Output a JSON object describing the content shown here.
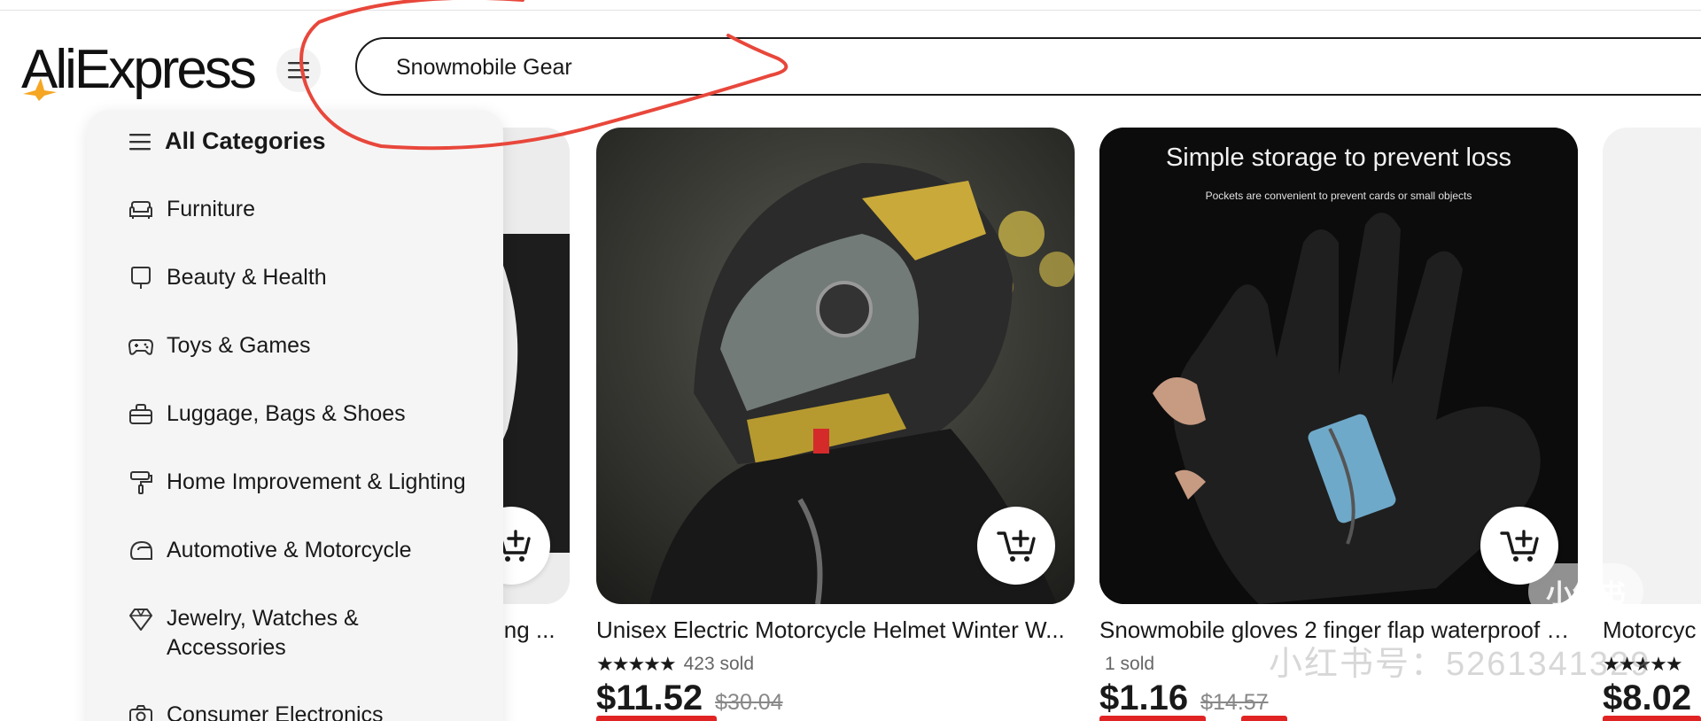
{
  "header": {
    "logo_text": "AliExpress",
    "menu_icon": "hamburger-icon",
    "search": {
      "value": "Snowmobile Gear",
      "placeholder": ""
    }
  },
  "categories": {
    "title": "All Categories",
    "items": [
      {
        "label": "Furniture",
        "icon": "sofa-icon"
      },
      {
        "label": "Beauty & Health",
        "icon": "mirror-icon"
      },
      {
        "label": "Toys & Games",
        "icon": "gamepad-icon"
      },
      {
        "label": "Luggage, Bags & Shoes",
        "icon": "bag-icon"
      },
      {
        "label": "Home Improvement & Lighting",
        "icon": "paint-roller-icon"
      },
      {
        "label": "Automotive & Motorcycle",
        "icon": "helmet-icon"
      },
      {
        "label": "Jewelry, Watches & Accessories",
        "icon": "diamond-icon"
      },
      {
        "label": "Consumer Electronics",
        "icon": "camera-icon"
      }
    ]
  },
  "products": [
    {
      "title": "ing ...",
      "rating": "",
      "sold": "",
      "price": "",
      "old_price": ""
    },
    {
      "title": "Unisex Electric Motorcycle Helmet Winter W...",
      "rating_stars": "★★★★★",
      "sold": "423 sold",
      "price": "$11.52",
      "old_price": "$30.04"
    },
    {
      "title": "Snowmobile gloves 2 finger flap waterproof g...",
      "rating_stars": "",
      "sold": "1 sold",
      "price": "$1.16",
      "old_price": "$14.57",
      "image_headline": "Simple storage to prevent loss",
      "image_subline": "Pockets are convenient to prevent cards or small objects"
    },
    {
      "title": "Motorcyc",
      "rating_stars": "★★★★★",
      "sold": "",
      "price": "$8.02",
      "old_price": ""
    }
  ],
  "watermark": {
    "text": "小红书号：5261341329",
    "badge": "小红书"
  },
  "colors": {
    "accent": "#e02424",
    "logo_star": "#f5a623",
    "scribble": "#e8473b"
  }
}
